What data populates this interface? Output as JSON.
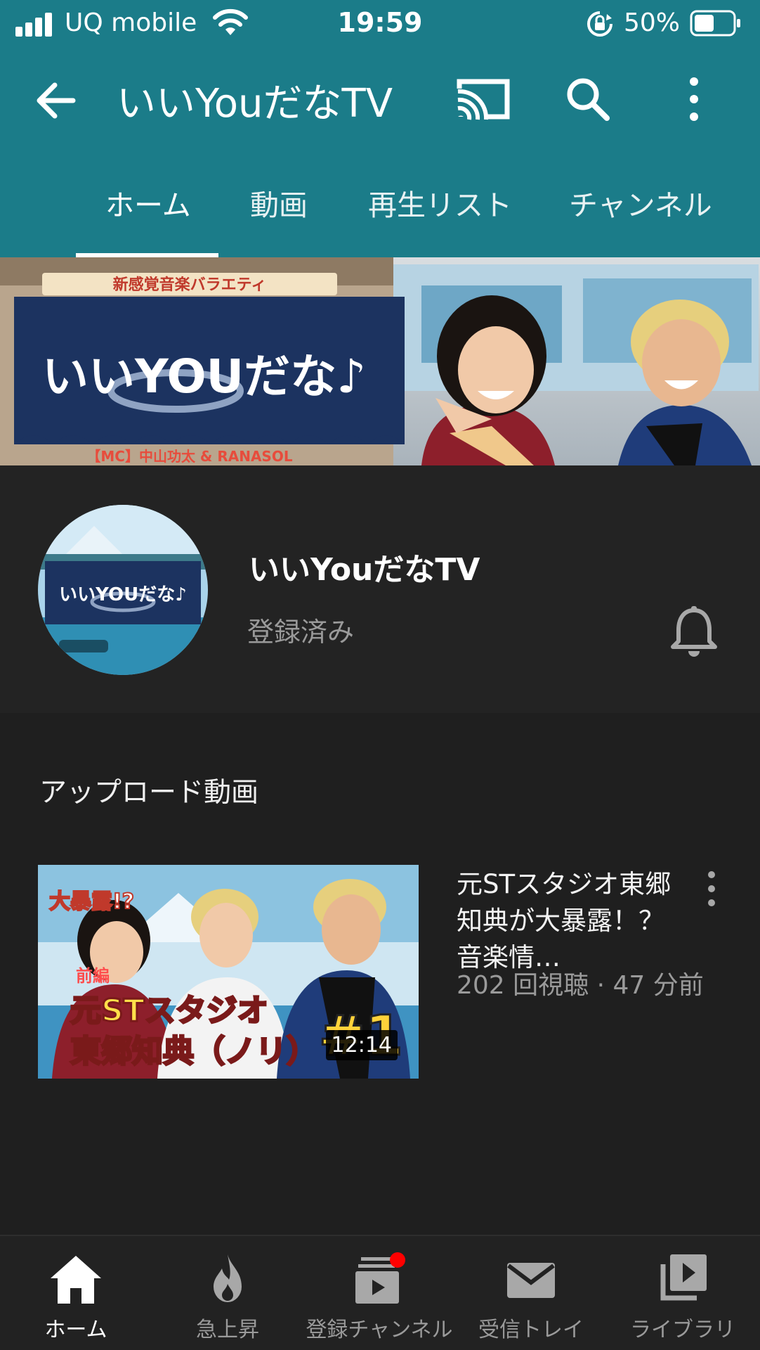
{
  "status_bar": {
    "carrier": "UQ mobile",
    "time": "19:59",
    "battery": "50%"
  },
  "nav": {
    "title": "いいYouだなTV"
  },
  "tabs": [
    {
      "label": "ホーム",
      "active": true
    },
    {
      "label": "動画"
    },
    {
      "label": "再生リスト"
    },
    {
      "label": "チャンネル"
    }
  ],
  "banner": {
    "subtitle": "新感覚音楽バラエティ",
    "logo_text": "いいYOUだな♪",
    "mc_text": "【MC】中山功太 & RANASOL"
  },
  "channel": {
    "name": "いいYouだなTV",
    "subscription_status": "登録済み",
    "avatar_logo": "いいYOUだな♪"
  },
  "uploads": {
    "section_title": "アップロード動画",
    "videos": [
      {
        "title": "元STスタジオ東郷知典が大暴露！？ 音楽情…",
        "meta": "202 回視聴 · 47 分前",
        "duration": "12:14",
        "thumbnail_text": {
          "badge": "大暴露!?",
          "part": "前編",
          "line1": "元STスタジオ",
          "line2": "東郷知典（ノリ）",
          "number": "#1"
        }
      }
    ]
  },
  "bottom_nav": [
    {
      "label": "ホーム",
      "icon": "home-icon",
      "active": true
    },
    {
      "label": "急上昇",
      "icon": "trending-icon"
    },
    {
      "label": "登録チャンネル",
      "icon": "subscriptions-icon"
    },
    {
      "label": "受信トレイ",
      "icon": "inbox-icon"
    },
    {
      "label": "ライブラリ",
      "icon": "library-icon"
    }
  ],
  "colors": {
    "header": "#1b7c89",
    "background": "#1f1f1f",
    "notification_dot": "#ff0000"
  }
}
